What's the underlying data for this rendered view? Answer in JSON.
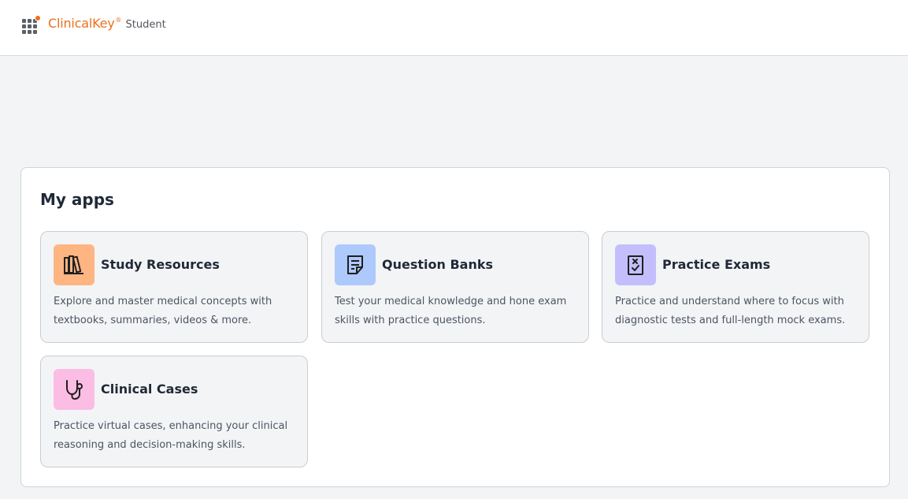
{
  "header": {
    "brand_name": "ClinicalKey",
    "brand_reg": "®",
    "brand_sub": "Student",
    "grid_icon": "apps-grid-icon",
    "accent_color": "#e9711c"
  },
  "panel": {
    "title": "My apps",
    "apps": [
      {
        "title": "Study Resources",
        "description": "Explore and master medical concepts with textbooks, summaries, videos & more.",
        "icon": "books-icon",
        "tile_color": "#ffb582"
      },
      {
        "title": "Question Banks",
        "description": "Test your medical knowledge and hone exam skills with practice questions.",
        "icon": "document-icon",
        "tile_color": "#aec9fb"
      },
      {
        "title": "Practice Exams",
        "description": "Practice and understand where to focus with diagnostic tests and full-length mock exams.",
        "icon": "checklist-icon",
        "tile_color": "#c4bffc"
      },
      {
        "title": "Clinical Cases",
        "description": "Practice virtual cases, enhancing your clinical reasoning and decision-making skills.",
        "icon": "stethoscope-icon",
        "tile_color": "#fbbde3"
      }
    ]
  }
}
